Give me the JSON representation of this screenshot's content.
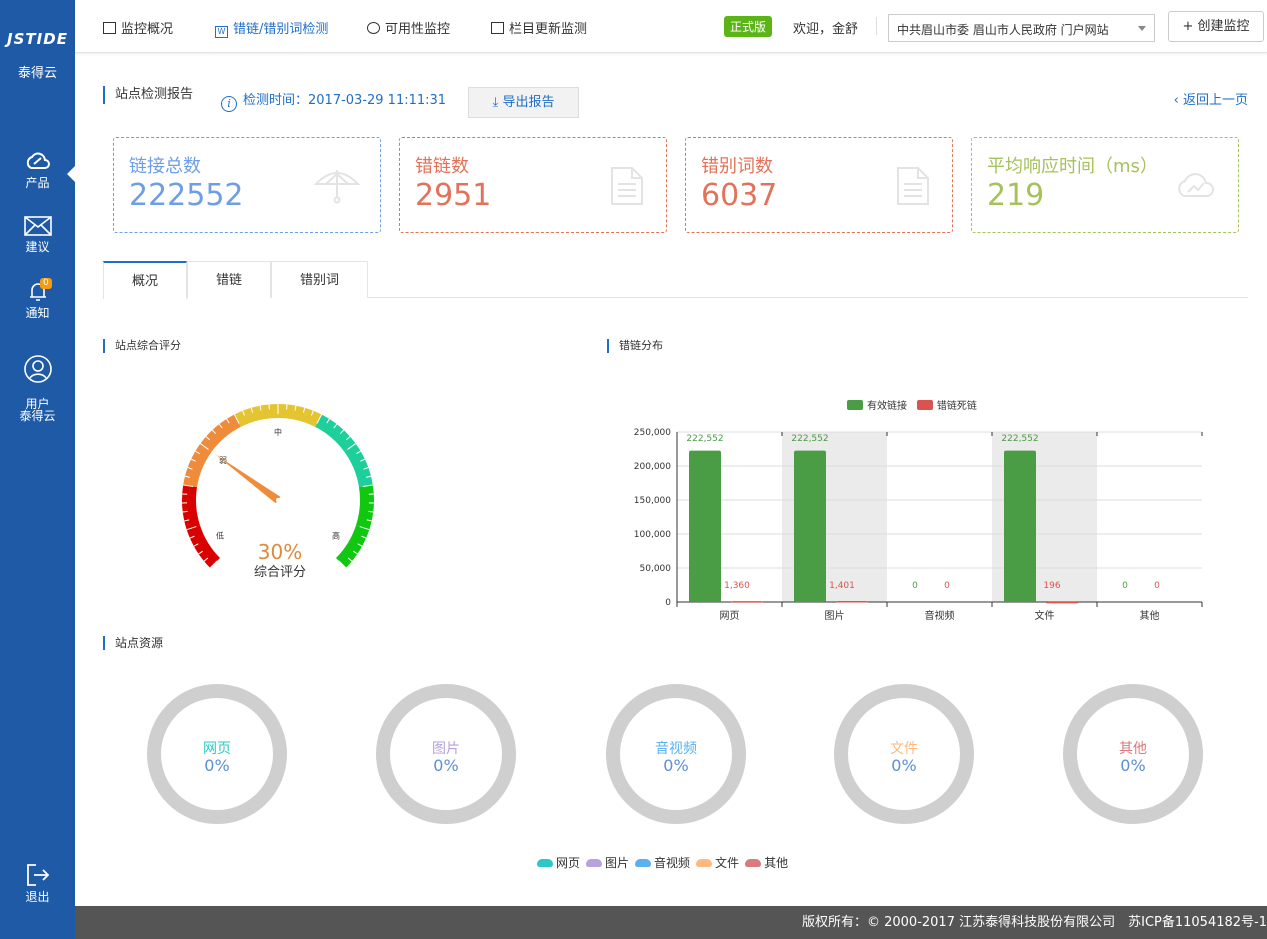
{
  "sidebar": {
    "logo": "JSTIDE",
    "logo_sub": "泰得云",
    "items": [
      {
        "label": "产品"
      },
      {
        "label": "建议"
      },
      {
        "label": "通知",
        "badge": "0"
      },
      {
        "label": "用户\n泰得云"
      }
    ],
    "logout": "退出"
  },
  "topnav": {
    "items": [
      "监控概况",
      "错链/错别词检测",
      "可用性监控",
      "栏目更新监测"
    ],
    "edition": "正式版",
    "welcome": "欢迎，金舒",
    "site_select": "中共眉山市委 眉山市人民政府 门户网站",
    "create_button": "+ 创建监控"
  },
  "report": {
    "title": "站点检测报告",
    "check_time": "检测时间：2017-03-29 11:11:31",
    "export_button": "导出报告",
    "back_link": "返回上一页"
  },
  "cards": [
    {
      "label": "链接总数",
      "value": "222552",
      "color": "#6d9ee6"
    },
    {
      "label": "错链数",
      "value": "2951",
      "color": "#e2735a"
    },
    {
      "label": "错别词数",
      "value": "6037",
      "color": "#e2735a"
    },
    {
      "label": "平均响应时间（ms）",
      "value": "219",
      "color": "#a5c25c"
    }
  ],
  "tabs": [
    "概况",
    "错链",
    "错别词"
  ],
  "score": {
    "section_title": "站点综合评分",
    "percent": "30%",
    "label": "综合评分",
    "gauge_labels": [
      "弱",
      "低",
      "中",
      "高"
    ],
    "value_fraction": 0.3
  },
  "chart_section_title": "错链分布",
  "chart_data": {
    "type": "bar",
    "categories": [
      "网页",
      "图片",
      "音视频",
      "文件",
      "其他"
    ],
    "series": [
      {
        "name": "有效链接",
        "values": [
          222552,
          222552,
          0,
          222552,
          0
        ],
        "color": "#4a9c45"
      },
      {
        "name": "错链死链",
        "values": [
          1360,
          1401,
          0,
          196,
          0
        ],
        "color": "#d9534f"
      }
    ],
    "data_labels": [
      [
        "222,552",
        "222,552",
        "0",
        "222,552",
        "0"
      ],
      [
        "1,360",
        "1,401",
        "0",
        "196",
        "0"
      ]
    ],
    "yticks": [
      "0",
      "50,000",
      "100,000",
      "150,000",
      "200,000",
      "250,000"
    ],
    "ylim": [
      0,
      250000
    ],
    "highlighted_categories": [
      "图片",
      "文件"
    ],
    "grid": true,
    "legend_position": "top"
  },
  "resources": {
    "section_title": "站点资源",
    "donuts": [
      {
        "label": "网页",
        "value": "0%",
        "color": "#2ec7c9"
      },
      {
        "label": "图片",
        "value": "0%",
        "color": "#b6a2de"
      },
      {
        "label": "音视频",
        "value": "0%",
        "color": "#5ab1ef"
      },
      {
        "label": "文件",
        "value": "0%",
        "color": "#ffb980"
      },
      {
        "label": "其他",
        "value": "0%",
        "color": "#d87a80"
      }
    ]
  },
  "footer": "版权所有：© 2000-2017 江苏泰得科技股份有限公司　苏ICP备11054182号-1"
}
